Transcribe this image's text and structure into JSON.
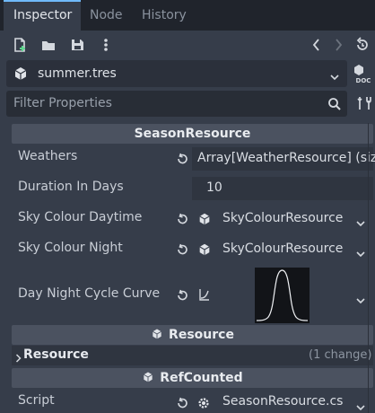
{
  "tabs": [
    {
      "label": "Inspector",
      "active": true
    },
    {
      "label": "Node",
      "active": false
    },
    {
      "label": "History",
      "active": false
    }
  ],
  "toolbar": {
    "icons": [
      "new-resource-icon",
      "load-resource-icon",
      "save-resource-icon",
      "more-menu-icon",
      "history-back-icon",
      "history-forward-icon",
      "object-history-icon"
    ]
  },
  "resource_selector": {
    "name": "summer.tres",
    "doc_label": "DOC"
  },
  "filter": {
    "placeholder": "Filter Properties"
  },
  "sections": {
    "season_resource": "SeasonResource",
    "resource": "Resource",
    "ref_counted": "RefCounted"
  },
  "properties": {
    "weathers": {
      "label": "Weathers",
      "value": "Array[WeatherResource] (siz"
    },
    "duration": {
      "label": "Duration In Days",
      "value": "10"
    },
    "sky_daytime": {
      "label": "Sky Colour Daytime",
      "value": "SkyColourResource"
    },
    "sky_night": {
      "label": "Sky Colour Night",
      "value": "SkyColourResource"
    },
    "day_night_curve": {
      "label": "Day Night Cycle Curve"
    },
    "resource_group": {
      "label": "Resource",
      "changes": "(1 change)"
    },
    "script": {
      "label": "Script",
      "value": "SeasonResource.cs"
    }
  },
  "colors": {
    "accent": "#70bafa",
    "panel_bg": "#363d4a",
    "tab_bar_bg": "#20242c",
    "section_bg": "#4b5260",
    "field_bg": "#2f3540"
  }
}
